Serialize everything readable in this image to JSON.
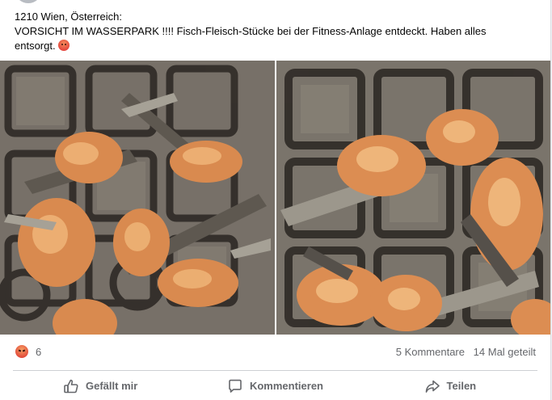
{
  "post": {
    "location_line": "1210 Wien, Österreich:",
    "body_line": "VORSICHT IM WASSERPARK !!!! Fisch-Fleisch-Stücke bei der Fitness-Anlage entdeckt. Haben alles",
    "body_end": "entsorgt.",
    "emoji_icon": "angry-face-icon"
  },
  "stats": {
    "reaction_icon": "angry-reaction-icon",
    "reaction_count": "6",
    "comments": "5 Kommentare",
    "shares": "14 Mal geteilt"
  },
  "actions": {
    "like_label": "Gefällt mir",
    "comment_label": "Kommentieren",
    "share_label": "Teilen"
  },
  "colors": {
    "secondary_text": "#65676b",
    "primary_text": "#050505",
    "background": "#ffffff",
    "divider": "#ced0d4"
  }
}
